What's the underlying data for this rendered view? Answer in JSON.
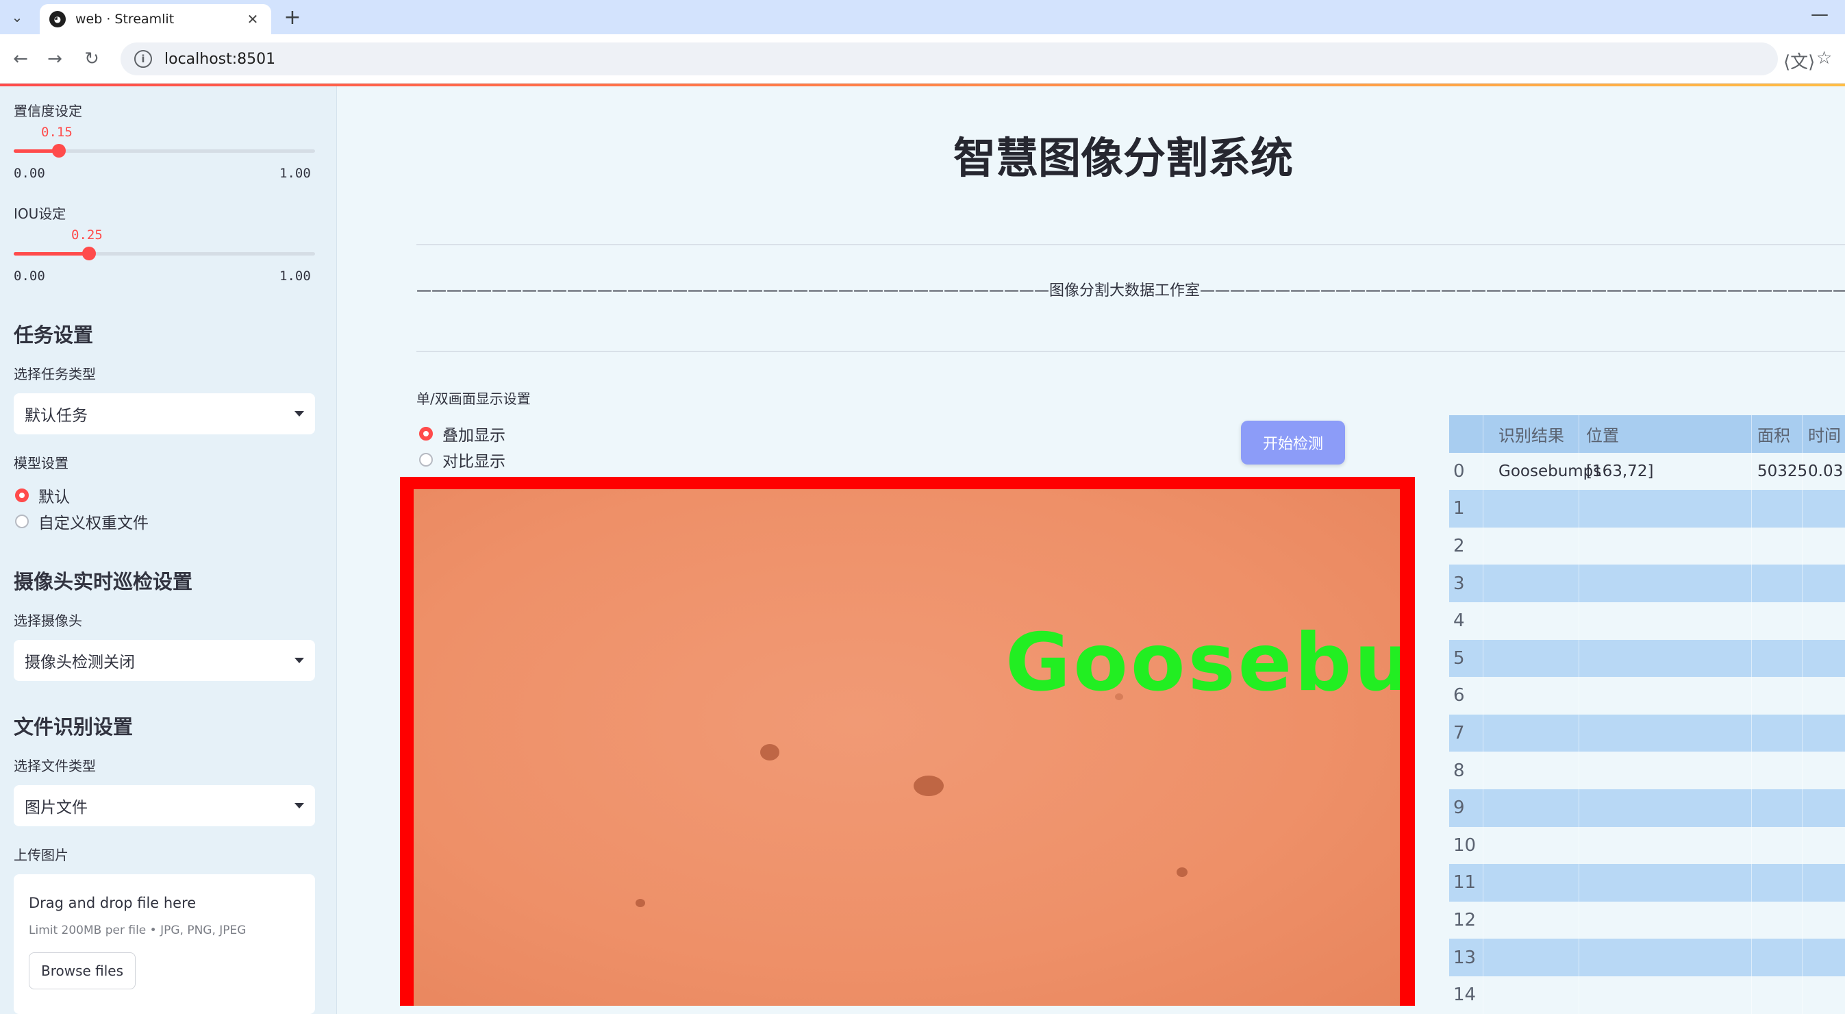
{
  "browser": {
    "tab_title": "web · Streamlit",
    "url": "localhost:8501"
  },
  "sidebar": {
    "confidence": {
      "label": "置信度设定",
      "value": 0.15,
      "value_text": "0.15",
      "min": "0.00",
      "max": "1.00"
    },
    "iou": {
      "label": "IOU设定",
      "value": 0.25,
      "value_text": "0.25",
      "min": "0.00",
      "max": "1.00"
    },
    "task_section": "任务设置",
    "task_type_label": "选择任务类型",
    "task_type_value": "默认任务",
    "model_label": "模型设置",
    "model_options": [
      "默认",
      "自定义权重文件"
    ],
    "model_selected": 0,
    "camera_section": "摄像头实时巡检设置",
    "camera_label": "选择摄像头",
    "camera_value": "摄像头检测关闭",
    "file_section": "文件识别设置",
    "file_type_label": "选择文件类型",
    "file_type_value": "图片文件",
    "upload_label": "上传图片",
    "upload_title": "Drag and drop file here",
    "upload_limit": "Limit 200MB per file • JPG, PNG, JPEG",
    "browse_label": "Browse files"
  },
  "main": {
    "title": "智慧图像分割系统",
    "subtitle_line": "——————————————————————————————————————————图像分割大数据工作室————————————————————————————————————————————",
    "display_label": "单/双画面显示设置",
    "display_options": [
      "叠加显示",
      "对比显示"
    ],
    "display_selected": 0,
    "start_button": "开始检测",
    "overlay_text": "Goosebumps"
  },
  "table": {
    "headers": [
      "",
      "识别结果",
      "位置",
      "面积",
      "时间"
    ],
    "rows": [
      [
        "0",
        "Goosebumps",
        "[163,72]",
        "50325",
        "0.03"
      ],
      [
        "1",
        "",
        "",
        "",
        ""
      ],
      [
        "2",
        "",
        "",
        "",
        ""
      ],
      [
        "3",
        "",
        "",
        "",
        ""
      ],
      [
        "4",
        "",
        "",
        "",
        ""
      ],
      [
        "5",
        "",
        "",
        "",
        ""
      ],
      [
        "6",
        "",
        "",
        "",
        ""
      ],
      [
        "7",
        "",
        "",
        "",
        ""
      ],
      [
        "8",
        "",
        "",
        "",
        ""
      ],
      [
        "9",
        "",
        "",
        "",
        ""
      ],
      [
        "10",
        "",
        "",
        "",
        ""
      ],
      [
        "11",
        "",
        "",
        "",
        ""
      ],
      [
        "12",
        "",
        "",
        "",
        ""
      ],
      [
        "13",
        "",
        "",
        "",
        ""
      ],
      [
        "14",
        "",
        "",
        "",
        ""
      ]
    ]
  },
  "colors": {
    "accent": "#ff4b4b",
    "button": "#8c9cf8",
    "frame": "#ff0000",
    "overlay_text": "#22ee22"
  }
}
